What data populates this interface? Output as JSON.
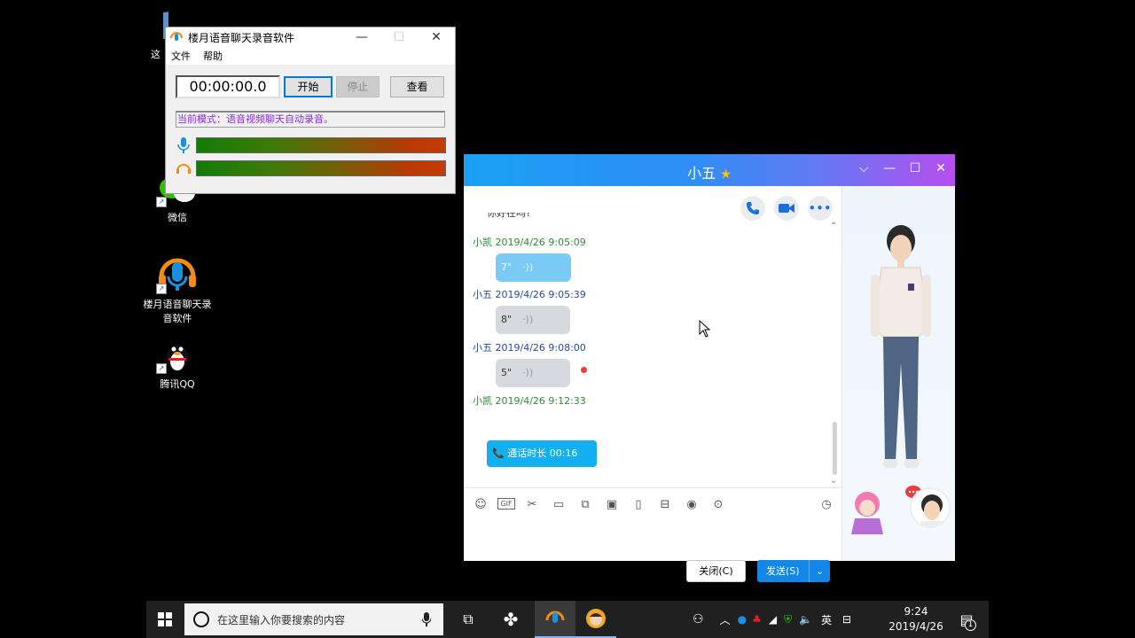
{
  "desktop": {
    "icons": [
      {
        "label": "微信"
      },
      {
        "label": "楼月语音聊天录音软件"
      },
      {
        "label": "腾讯QQ"
      }
    ],
    "partial_label": "这"
  },
  "recorder": {
    "title": "楼月语音聊天录音软件",
    "menu": [
      "文件",
      "帮助"
    ],
    "timer": "00:00:00.0",
    "start": "开始",
    "stop": "停止",
    "view": "查看",
    "mode": "当前模式：语音视频聊天自动录音。"
  },
  "chat": {
    "title": "小五",
    "cut_text": "你好在吗?",
    "messages": [
      {
        "head": "小凯 2019/4/26 9:05:09",
        "duration": "7\""
      },
      {
        "head": "小五 2019/4/26 9:05:39",
        "duration": "8\""
      },
      {
        "head": "小五 2019/4/26 9:08:00",
        "duration": "5\""
      },
      {
        "head": "小凯 2019/4/26 9:12:33",
        "call": "通话时长 00:16"
      }
    ],
    "close_label": "关闭(C)",
    "send_label": "发送(S)"
  },
  "taskbar": {
    "search_placeholder": "在这里输入你要搜索的内容",
    "ime": "英",
    "time": "9:24",
    "date": "2019/4/26",
    "notify_count": "1"
  },
  "colors": {
    "chat_accent": "#1287e8",
    "mine_bubble": "#7ccaf6",
    "call_bubble": "#12b0f0",
    "mode_text": "#8a2be2"
  }
}
